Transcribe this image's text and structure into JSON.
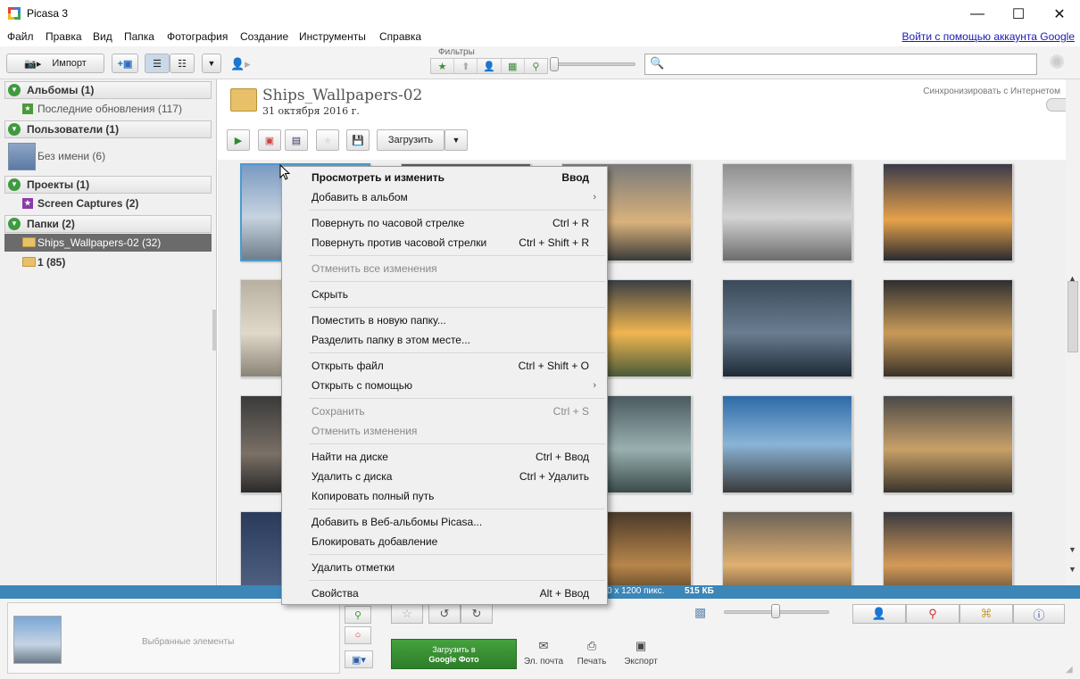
{
  "window": {
    "title": "Picasa 3",
    "controls": [
      "—",
      "☐",
      "✕"
    ]
  },
  "menubar": {
    "items": [
      "Файл",
      "Правка",
      "Вид",
      "Папка",
      "Фотография",
      "Создание",
      "Инструменты",
      "Справка"
    ],
    "login_link": "Войти с помощью аккаунта Google"
  },
  "toolbar": {
    "import_label": "Импорт",
    "filters_label": "Фильтры",
    "search_value": "",
    "filter_icons": [
      "star-icon",
      "upload-icon",
      "person-icon",
      "movie-icon",
      "pin-icon"
    ]
  },
  "sidebar": {
    "sections": [
      {
        "title": "Альбомы (1)",
        "items": [
          {
            "label": "Последние обновления (117)"
          }
        ]
      },
      {
        "title": "Пользователи (1)",
        "items": [
          {
            "label": "Без имени (6)"
          }
        ]
      },
      {
        "title": "Проекты (1)",
        "items": [
          {
            "label": "Screen Captures (2)"
          }
        ]
      },
      {
        "title": "Папки (2)",
        "items": [
          {
            "label": "Ships_Wallpapers-02 (32)",
            "selected": true
          },
          {
            "label": "1 (85)"
          }
        ]
      }
    ]
  },
  "album": {
    "title": "Ships_Wallpapers-02",
    "date": "31 октября 2016 г.",
    "sync_label": "Синхронизировать с Интернетом",
    "upload_label": "Загрузить"
  },
  "context_menu": {
    "items": [
      {
        "label": "Просмотреть и изменить",
        "shortcut": "Ввод",
        "bold": true
      },
      {
        "label": "Добавить в альбом",
        "submenu": "›"
      },
      {
        "sep": true
      },
      {
        "label": "Повернуть по часовой стрелке",
        "shortcut": "Ctrl + R"
      },
      {
        "label": "Повернуть против часовой стрелки",
        "shortcut": "Ctrl + Shift + R"
      },
      {
        "sep": true
      },
      {
        "label": "Отменить все изменения",
        "disabled": true
      },
      {
        "sep": true
      },
      {
        "label": "Скрыть"
      },
      {
        "sep": true
      },
      {
        "label": "Поместить в новую папку..."
      },
      {
        "label": "Разделить папку в этом месте..."
      },
      {
        "sep": true
      },
      {
        "label": "Открыть файл",
        "shortcut": "Ctrl + Shift + O"
      },
      {
        "label": "Открыть с помощью",
        "submenu": "›"
      },
      {
        "sep": true
      },
      {
        "label": "Сохранить",
        "shortcut": "Ctrl + S",
        "disabled": true
      },
      {
        "label": "Отменить изменения",
        "disabled": true
      },
      {
        "sep": true
      },
      {
        "label": "Найти на диске",
        "shortcut": "Ctrl + Ввод"
      },
      {
        "label": "Удалить с диска",
        "shortcut": "Ctrl + Удалить"
      },
      {
        "label": "Копировать полный путь"
      },
      {
        "sep": true
      },
      {
        "label": "Добавить в Веб-альбомы Picasa..."
      },
      {
        "label": "Блокировать добавление"
      },
      {
        "sep": true
      },
      {
        "label": "Удалить отметки"
      },
      {
        "sep": true
      },
      {
        "label": "Свойства",
        "shortcut": "Alt + Ввод"
      }
    ]
  },
  "statusbar": {
    "dimensions": "0 x 1200 пикс.",
    "size": "515 КБ"
  },
  "bottom": {
    "tray_label": "Выбранные элементы",
    "upload_line1": "Загрузить в",
    "upload_line2": "Google Фото",
    "email_label": "Эл. почта",
    "print_label": "Печать",
    "export_label": "Экспорт"
  },
  "colors": {
    "accent_blue": "#3c86b8",
    "upload_green": "#3a9334",
    "selection_gray": "#6b6b6b",
    "icon_green": "#3f9a3f"
  }
}
